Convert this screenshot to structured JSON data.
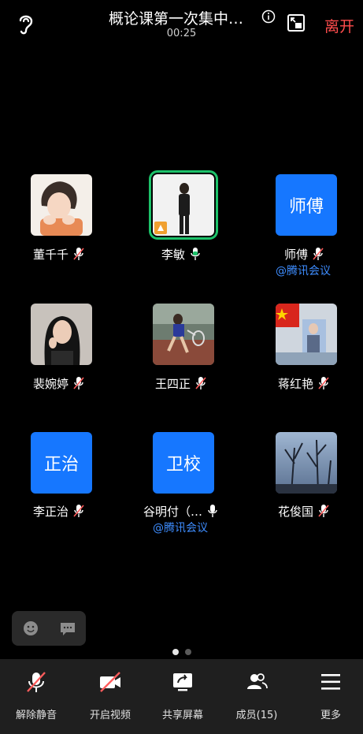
{
  "header": {
    "title": "概论课第一次集中…",
    "timer": "00:25",
    "leave_label": "离开"
  },
  "participants": [
    {
      "name": "董千千",
      "mic": "muted",
      "avatar": "photo"
    },
    {
      "name": "李敏",
      "mic": "on",
      "avatar": "photo",
      "speaking": true
    },
    {
      "name": "师傅",
      "mic": "muted",
      "avatar": "text",
      "avatar_text": "师傅",
      "sub": "@腾讯会议"
    },
    {
      "name": "裴婉婷",
      "mic": "muted",
      "avatar": "photo"
    },
    {
      "name": "王四正",
      "mic": "muted",
      "avatar": "photo"
    },
    {
      "name": "蒋红艳",
      "mic": "muted",
      "avatar": "photo"
    },
    {
      "name": "李正治",
      "mic": "muted",
      "avatar": "text",
      "avatar_text": "正治"
    },
    {
      "name": "谷明付（…",
      "mic": "on",
      "avatar": "text",
      "avatar_text": "卫校",
      "sub": "@腾讯会议"
    },
    {
      "name": "花俊国",
      "mic": "muted",
      "avatar": "photo"
    }
  ],
  "toolbar": [
    {
      "label": "解除静音",
      "icon": "mic-muted-icon"
    },
    {
      "label": "开启视频",
      "icon": "camera-off-icon"
    },
    {
      "label": "共享屏幕",
      "icon": "share-screen-icon"
    },
    {
      "label": "成员(15)",
      "icon": "members-icon"
    },
    {
      "label": "更多",
      "icon": "more-menu-icon"
    }
  ],
  "pager": {
    "pages": 2,
    "current": 1
  },
  "colors": {
    "accent": "#1677ff",
    "leave": "#ff4d4d",
    "speaking": "#1dc26a",
    "muted_mic": "#ff5c5c"
  }
}
